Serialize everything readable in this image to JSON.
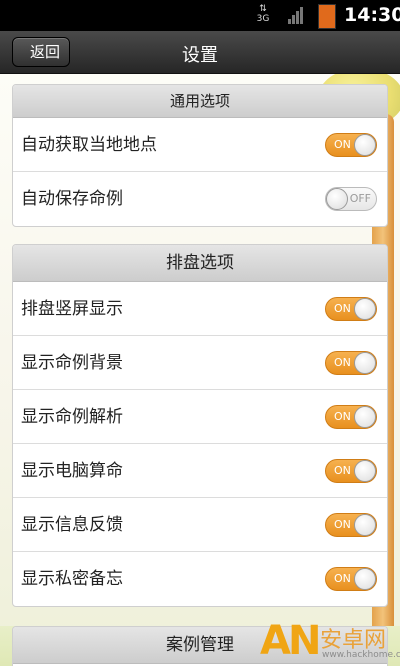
{
  "status_bar": {
    "network": "3G",
    "time": "14:30"
  },
  "nav": {
    "back_label": "返回",
    "title": "设置"
  },
  "groups": [
    {
      "header": "通用选项",
      "rows": [
        {
          "label": "自动获取当地地点",
          "toggle": "ON"
        },
        {
          "label": "自动保存命例",
          "toggle": "OFF"
        }
      ]
    },
    {
      "header": "排盘选项",
      "rows": [
        {
          "label": "排盘竖屏显示",
          "toggle": "ON"
        },
        {
          "label": "显示命例背景",
          "toggle": "ON"
        },
        {
          "label": "显示命例解析",
          "toggle": "ON"
        },
        {
          "label": "显示电脑算命",
          "toggle": "ON"
        },
        {
          "label": "显示信息反馈",
          "toggle": "ON"
        },
        {
          "label": "显示私密备忘",
          "toggle": "ON"
        }
      ]
    },
    {
      "header": "案例管理",
      "rows": []
    }
  ],
  "watermark": {
    "logo_text": "AN",
    "site_name": "安卓网",
    "url": "www.hackhome.com"
  },
  "colors": {
    "toggle_on": "#e8901f",
    "nav_bar": "#333333",
    "status_bar": "#000000"
  }
}
